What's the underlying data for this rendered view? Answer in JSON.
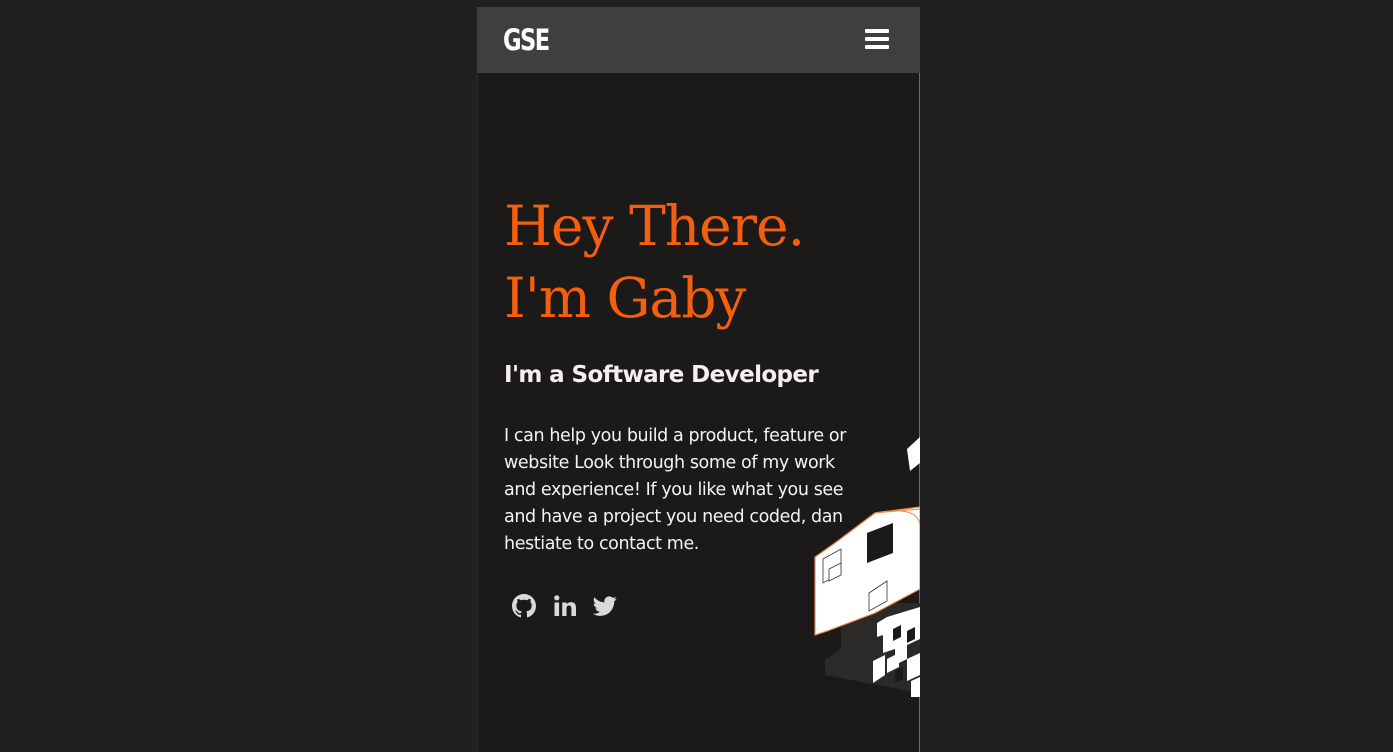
{
  "navbar": {
    "logo_text": "GSE",
    "menu_icon": "hamburger-menu-icon"
  },
  "hero": {
    "title_line1": "Hey There.",
    "title_line2": "I'm Gaby",
    "subtitle": "I'm a Software Developer",
    "intro_lines": [
      "I can help you build a product, feature or",
      "website Look through some of my work",
      "and experience! If you like what you see",
      "and have a project you need coded, dan",
      "hestiate to contact me."
    ]
  },
  "socials": [
    {
      "name": "github-icon"
    },
    {
      "name": "linkedin-icon"
    },
    {
      "name": "twitter-icon"
    }
  ],
  "colors": {
    "page_background": "#202022",
    "panel_background": "#1c1a19",
    "navbar_background": "#403e3e",
    "accent": "#f45e0f",
    "text": "#f5f3f1",
    "icon": "#d9d9d9"
  }
}
